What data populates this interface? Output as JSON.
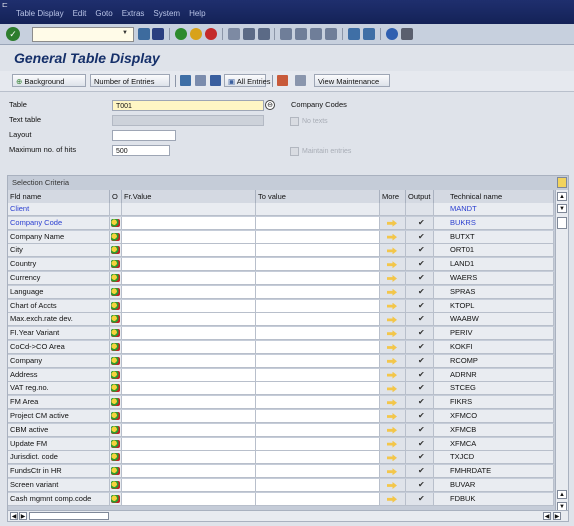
{
  "menu": [
    "Table Display",
    "Edit",
    "Goto",
    "Extras",
    "System",
    "Help"
  ],
  "title": "General Table Display",
  "toolbar": {
    "background": "Background",
    "number_of_entries": "Number of Entries",
    "all_entries": "All Entries",
    "view_maintenance": "View Maintenance"
  },
  "form": {
    "table_label": "Table",
    "table_value": "T001",
    "table_desc": "Company Codes",
    "texttable_label": "Text table",
    "no_texts_label": "No texts",
    "layout_label": "Layout",
    "maxhits_label": "Maximum no. of hits",
    "maxhits_value": "500",
    "maintain_entries_label": "Maintain entries"
  },
  "selection": {
    "title": "Selection Criteria",
    "headers": [
      "Fld name",
      "O",
      "Fr.Value",
      "To value",
      "More",
      "Output",
      "Technical name"
    ],
    "rows": [
      {
        "name": "Client",
        "tech": "MANDT",
        "key": true,
        "output": false
      },
      {
        "name": "Company Code",
        "tech": "BUKRS",
        "key": true,
        "output": true
      },
      {
        "name": "Company Name",
        "tech": "BUTXT",
        "key": false,
        "output": true
      },
      {
        "name": "City",
        "tech": "ORT01",
        "key": false,
        "output": true
      },
      {
        "name": "Country",
        "tech": "LAND1",
        "key": false,
        "output": true
      },
      {
        "name": "Currency",
        "tech": "WAERS",
        "key": false,
        "output": true
      },
      {
        "name": "Language",
        "tech": "SPRAS",
        "key": false,
        "output": true
      },
      {
        "name": "Chart of Accts",
        "tech": "KTOPL",
        "key": false,
        "output": true
      },
      {
        "name": "Max.exch.rate dev.",
        "tech": "WAABW",
        "key": false,
        "output": true
      },
      {
        "name": "FI.Year Variant",
        "tech": "PERIV",
        "key": false,
        "output": true
      },
      {
        "name": "CoCd->CO Area",
        "tech": "KOKFI",
        "key": false,
        "output": true
      },
      {
        "name": "Company",
        "tech": "RCOMP",
        "key": false,
        "output": true
      },
      {
        "name": "Address",
        "tech": "ADRNR",
        "key": false,
        "output": true
      },
      {
        "name": "VAT reg.no.",
        "tech": "STCEG",
        "key": false,
        "output": true
      },
      {
        "name": "FM Area",
        "tech": "FIKRS",
        "key": false,
        "output": true
      },
      {
        "name": "Project CM active",
        "tech": "XFMCO",
        "key": false,
        "output": true
      },
      {
        "name": "CBM active",
        "tech": "XFMCB",
        "key": false,
        "output": true
      },
      {
        "name": "Update FM",
        "tech": "XFMCA",
        "key": false,
        "output": true
      },
      {
        "name": "Jurisdict. code",
        "tech": "TXJCD",
        "key": false,
        "output": true
      },
      {
        "name": "FundsCtr in HR",
        "tech": "FMHRDATE",
        "key": false,
        "output": true
      },
      {
        "name": "Screen variant",
        "tech": "BUVAR",
        "key": false,
        "output": true
      },
      {
        "name": "Cash mgmnt comp.code",
        "tech": "FDBUK",
        "key": false,
        "output": true
      }
    ]
  },
  "colors": {
    "menubar": "#1f2f6e",
    "title": "#16306a",
    "key_field": "#2b3fd0",
    "required_field": "#fff6c4"
  }
}
